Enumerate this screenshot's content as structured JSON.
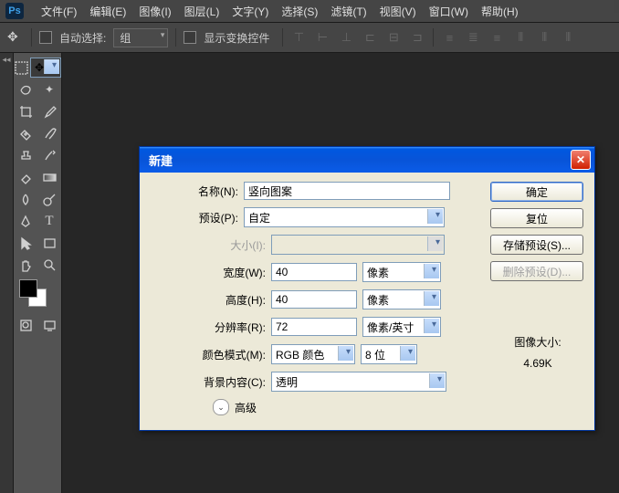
{
  "menu": {
    "file": "文件(F)",
    "edit": "编辑(E)",
    "image": "图像(I)",
    "layer": "图层(L)",
    "type": "文字(Y)",
    "select": "选择(S)",
    "filter": "滤镜(T)",
    "view": "视图(V)",
    "window": "窗口(W)",
    "help": "帮助(H)"
  },
  "optbar": {
    "autoselect": "自动选择:",
    "group": "组",
    "showcontrols": "显示变换控件"
  },
  "dialog": {
    "title": "新建",
    "labels": {
      "name": "名称(N):",
      "preset": "预设(P):",
      "size": "大小(I):",
      "width": "宽度(W):",
      "height": "高度(H):",
      "res": "分辨率(R):",
      "mode": "颜色模式(M):",
      "bg": "背景内容(C):",
      "adv": "高级"
    },
    "values": {
      "name": "竖向图案",
      "preset": "自定",
      "width": "40",
      "height": "40",
      "res": "72",
      "mode": "RGB 颜色",
      "bits": "8 位",
      "bg": "透明",
      "wunit": "像素",
      "hunit": "像素",
      "runit": "像素/英寸"
    },
    "buttons": {
      "ok": "确定",
      "reset": "复位",
      "save": "存储预设(S)...",
      "delete": "删除预设(D)..."
    },
    "info": {
      "label": "图像大小:",
      "size": "4.69K"
    }
  }
}
